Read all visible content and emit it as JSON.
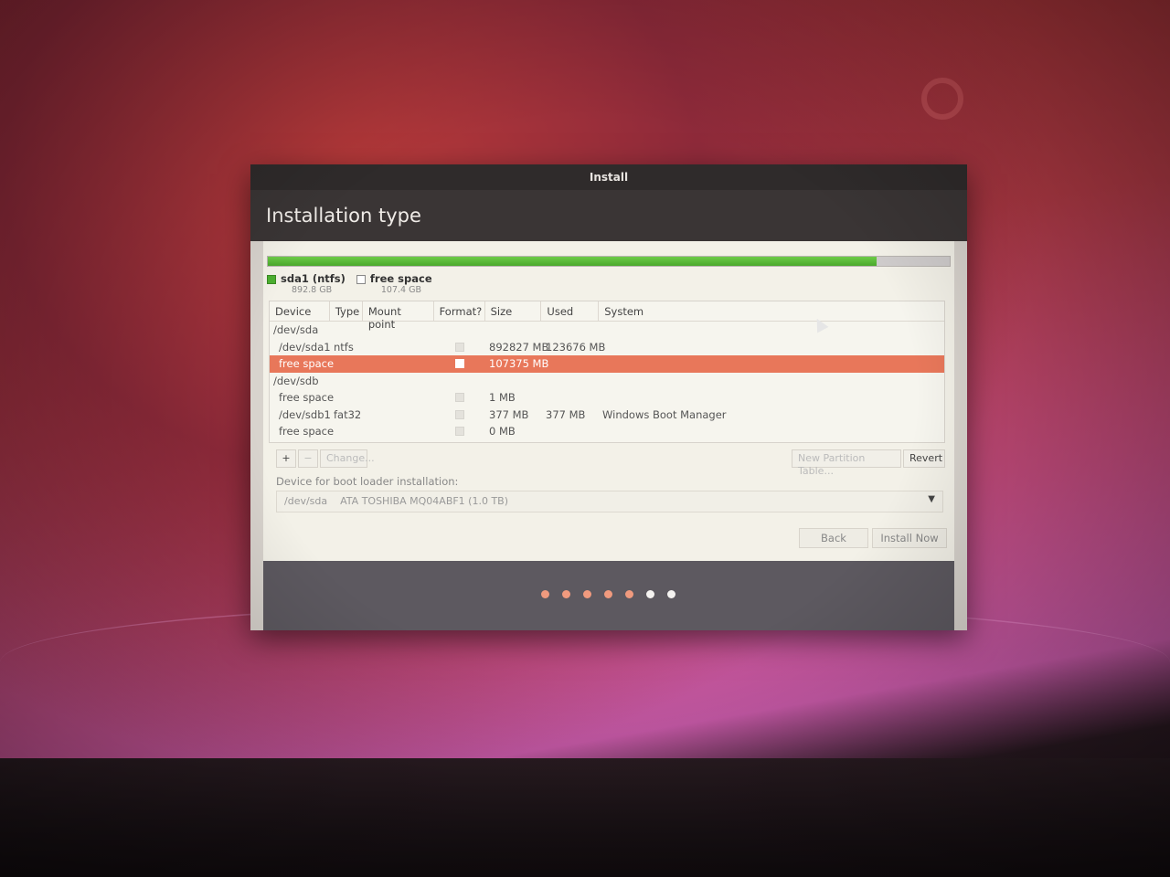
{
  "window": {
    "title": "Install",
    "heading": "Installation type"
  },
  "partition_bar": {
    "used_fraction": 0.893,
    "legend": [
      {
        "name": "sda1 (ntfs)",
        "size": "892.8 GB",
        "color": "#4caf30"
      },
      {
        "name": "free space",
        "size": "107.4 GB",
        "color": "#ffffff"
      }
    ]
  },
  "table": {
    "headers": [
      "Device",
      "Type",
      "Mount point",
      "Format?",
      "Size",
      "Used",
      "System"
    ],
    "rows": [
      {
        "device": "/dev/sda",
        "type": "",
        "size": "",
        "used": "",
        "system": "",
        "checkbox": false,
        "selected": false
      },
      {
        "device": "/dev/sda1",
        "type": "ntfs",
        "size": "892827 MB",
        "used": "123676 MB",
        "system": "",
        "checkbox": true,
        "selected": false
      },
      {
        "device": "free space",
        "type": "",
        "size": "107375 MB",
        "used": "",
        "system": "",
        "checkbox": true,
        "selected": true
      },
      {
        "device": "/dev/sdb",
        "type": "",
        "size": "",
        "used": "",
        "system": "",
        "checkbox": false,
        "selected": false
      },
      {
        "device": "free space",
        "type": "",
        "size": "1 MB",
        "used": "",
        "system": "",
        "checkbox": true,
        "selected": false
      },
      {
        "device": "/dev/sdb1",
        "type": "fat32",
        "size": "377 MB",
        "used": "377 MB",
        "system": "Windows Boot Manager",
        "checkbox": true,
        "selected": false
      },
      {
        "device": "free space",
        "type": "",
        "size": "0 MB",
        "used": "",
        "system": "",
        "checkbox": true,
        "selected": false
      }
    ]
  },
  "toolbar": {
    "add_label": "+",
    "remove_label": "−",
    "change_label": "Change...",
    "new_table_label": "New Partition Table...",
    "revert_label": "Revert"
  },
  "bootloader": {
    "label": "Device for boot loader installation:",
    "selected_device": "/dev/sda",
    "selected_name": "ATA TOSHIBA MQ04ABF1 (1.0 TB)"
  },
  "buttons": {
    "back_label": "Back",
    "install_label": "Install Now"
  },
  "progress": {
    "total_steps": 7,
    "current_step": 6
  }
}
